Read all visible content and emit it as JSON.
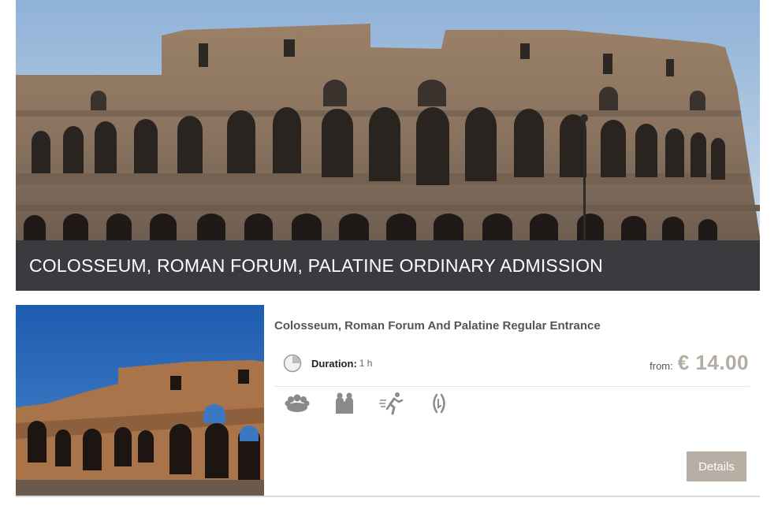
{
  "hero": {
    "title": "COLOSSEUM, ROMAN FORUM, PALATINE ORDINARY ADMISSION",
    "image": "colosseum-photo"
  },
  "tour_card": {
    "image": "colosseum-photo",
    "name": "Colosseum, Roman Forum And Palatine Regular Entrance",
    "duration_label": "Duration:",
    "duration_value": "1 h",
    "price_from": "from:",
    "price": "€ 14.00",
    "features": [
      {
        "icon": "group-icon"
      },
      {
        "icon": "family-icon"
      },
      {
        "icon": "fast-entry-icon"
      },
      {
        "icon": "audio-guide-icon"
      }
    ],
    "details_label": "Details"
  },
  "colors": {
    "title_bar": "#3a3b3e",
    "price": "#b5aca2",
    "button": "#b8aea3",
    "icon": "#8a8a8a"
  }
}
